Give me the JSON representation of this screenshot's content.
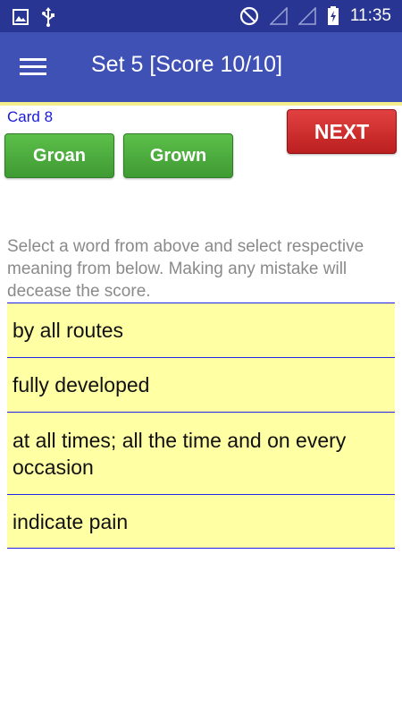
{
  "status_bar": {
    "time": "11:35",
    "icons": [
      "image-icon",
      "usb-icon",
      "do-not-disturb-icon",
      "no-signal-icon",
      "no-signal-icon",
      "battery-charging-icon"
    ]
  },
  "app_bar": {
    "title": "Set 5 [Score 10/10]",
    "menu_icon": "hamburger-menu-icon",
    "color": "#3f51b5"
  },
  "card": {
    "label": "Card 8"
  },
  "words": [
    {
      "label": "Groan"
    },
    {
      "label": "Grown"
    }
  ],
  "next_button": {
    "label": "NEXT"
  },
  "instructions": "Select a word from above and select respective meaning from below. Making any mistake will decease the score.",
  "meanings": [
    {
      "text": "by all routes"
    },
    {
      "text": "fully developed"
    },
    {
      "text": "at all times; all the time and on every occasion"
    },
    {
      "text": "indicate pain"
    }
  ],
  "colors": {
    "word_button": "#4caf3f",
    "next_button": "#d32f2f",
    "meaning_background": "#ffffa4",
    "meaning_divider": "#2222ee"
  }
}
